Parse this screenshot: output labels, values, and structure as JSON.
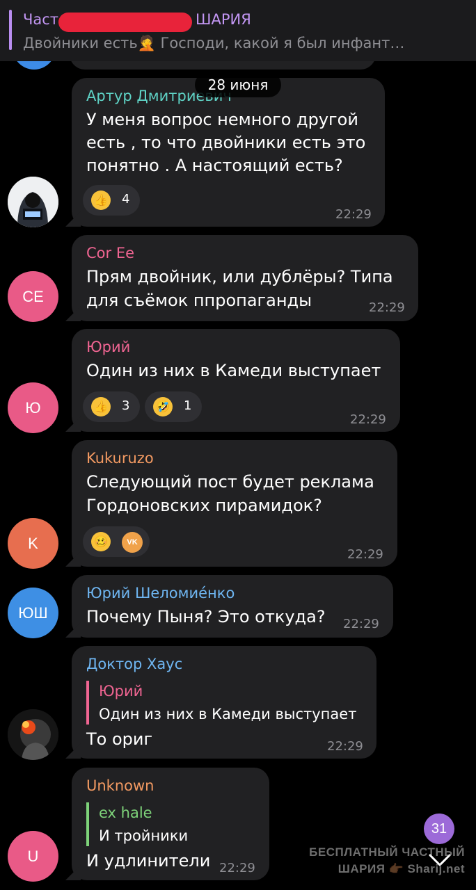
{
  "pinned": {
    "title_left": "Част",
    "title_right": "ШАРИЯ",
    "text": "Двойники есть🤦 Господи, какой я был инфант…"
  },
  "date_label": "28 июня",
  "messages": [
    {
      "sender": "Артур Дмитриевич",
      "sender_color": "#5fd3c6",
      "lines": [
        "У меня вопрос немного другой",
        "есть , то что двойники есть это",
        "понятно . А настоящий есть?"
      ],
      "time": "22:29",
      "reactions": [
        {
          "emoji": "thumbs-up",
          "glyph": "👍",
          "count": "4"
        }
      ],
      "avatar": {
        "type": "image",
        "icon": "hacker-avatar-icon"
      }
    },
    {
      "sender": "Cor Ee",
      "sender_color": "#f06592",
      "lines": [
        "Прям двойник, или дублёры? Типа",
        "для съёмок ппропаганды"
      ],
      "time": "22:29",
      "avatar": {
        "initials": "CE",
        "color": "#e95a87"
      }
    },
    {
      "sender": "Юрий",
      "sender_color": "#f06592",
      "lines": [
        "Один из них в Камеди выступает"
      ],
      "time": "22:29",
      "reactions": [
        {
          "emoji": "thumbs-up",
          "glyph": "👍",
          "count": "3"
        },
        {
          "emoji": "rofl",
          "glyph": "🤣",
          "count": "1"
        }
      ],
      "avatar": {
        "initials": "Ю",
        "color": "#e95a87"
      }
    },
    {
      "sender": "Kukuruzo",
      "sender_color": "#f39a62",
      "lines": [
        "Следующий пост будет реклама",
        "Гордоновских пирамидок?"
      ],
      "time": "22:29",
      "reactions": [
        {
          "emoji": "woozy-face",
          "glyph": "🥴",
          "count": "",
          "extra": "VK"
        }
      ],
      "avatar": {
        "initials": "K",
        "color": "#e76e4f"
      }
    },
    {
      "sender": "Юрий Шеломиéнко",
      "sender_color": "#6fb6f2",
      "lines": [
        "Почему Пыня? Это откуда?"
      ],
      "time": "22:29",
      "avatar": {
        "initials": "ЮШ",
        "color": "#3e8fe4"
      }
    },
    {
      "sender": "Доктор Хаус",
      "sender_color": "#6fb6f2",
      "reply": {
        "name": "Юрий",
        "text": "Один из них в Камеди выступает",
        "color": "#f06592"
      },
      "lines": [
        "То ориг"
      ],
      "time": "22:29",
      "avatar": {
        "type": "image",
        "icon": "doctor-avatar-icon"
      }
    },
    {
      "sender": "Unknown",
      "sender_color": "#f39a62",
      "reply": {
        "name": "ex hale",
        "text": "И тройники",
        "color": "#7ed37a"
      },
      "lines": [
        "И удлинители"
      ],
      "time": "22:29",
      "avatar": {
        "initials": "U",
        "color": "#e95a87"
      }
    }
  ],
  "unread_count": "31",
  "watermark": {
    "line1": "БЕСПЛАТНЫЙ ЧАСТНЫЙ",
    "line2": "ШАРИЯ 👉🏾 Sharij.net"
  }
}
